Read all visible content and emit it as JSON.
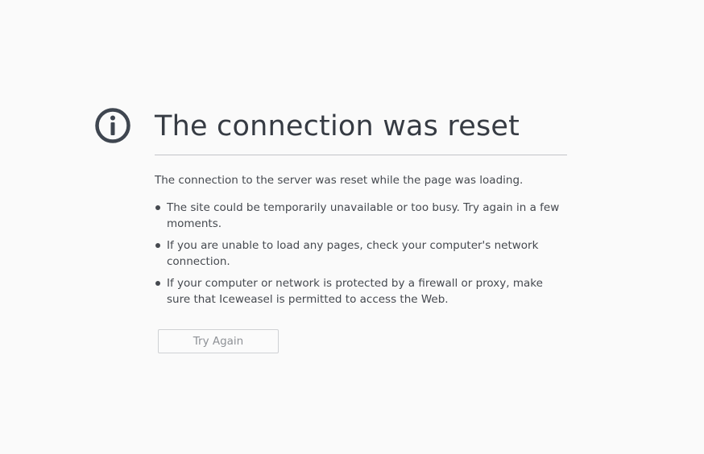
{
  "error_page": {
    "title": "The connection was reset",
    "description": "The connection to the server was reset while the page was loading.",
    "reasons": [
      "The site could be temporarily unavailable or too busy. Try again in a few moments.",
      "If you are unable to load any pages, check your computer's network connection.",
      "If your computer or network is protected by a firewall or proxy, make sure that Iceweasel is permitted to access the Web."
    ],
    "try_again_label": "Try Again",
    "icon": "info-icon"
  },
  "colors": {
    "background": "#fafafa",
    "text": "#45494f",
    "icon": "#3f4650"
  }
}
